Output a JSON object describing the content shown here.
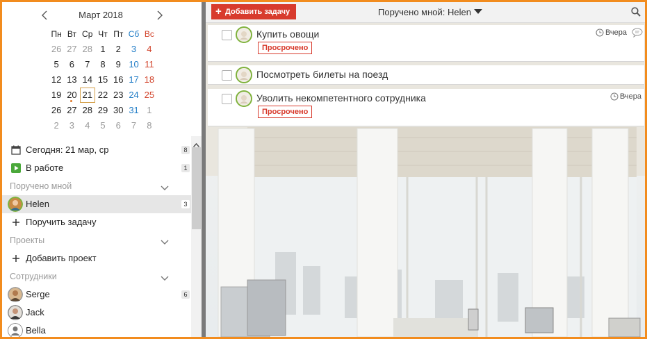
{
  "calendar": {
    "title": "Март 2018",
    "weekdays": [
      {
        "label": "Пн",
        "kind": "norm"
      },
      {
        "label": "Вт",
        "kind": "norm"
      },
      {
        "label": "Ср",
        "kind": "norm"
      },
      {
        "label": "Чт",
        "kind": "norm"
      },
      {
        "label": "Пт",
        "kind": "norm"
      },
      {
        "label": "Сб",
        "kind": "sat"
      },
      {
        "label": "Вс",
        "kind": "sun"
      }
    ],
    "weeks": [
      [
        {
          "d": "26",
          "k": "muted"
        },
        {
          "d": "27",
          "k": "muted"
        },
        {
          "d": "28",
          "k": "muted"
        },
        {
          "d": "1",
          "k": "norm"
        },
        {
          "d": "2",
          "k": "norm"
        },
        {
          "d": "3",
          "k": "sat"
        },
        {
          "d": "4",
          "k": "sun"
        }
      ],
      [
        {
          "d": "5",
          "k": "norm"
        },
        {
          "d": "6",
          "k": "norm"
        },
        {
          "d": "7",
          "k": "norm"
        },
        {
          "d": "8",
          "k": "norm"
        },
        {
          "d": "9",
          "k": "norm"
        },
        {
          "d": "10",
          "k": "sat"
        },
        {
          "d": "11",
          "k": "sun"
        }
      ],
      [
        {
          "d": "12",
          "k": "norm"
        },
        {
          "d": "13",
          "k": "norm"
        },
        {
          "d": "14",
          "k": "norm"
        },
        {
          "d": "15",
          "k": "norm"
        },
        {
          "d": "16",
          "k": "norm"
        },
        {
          "d": "17",
          "k": "sat"
        },
        {
          "d": "18",
          "k": "sun"
        }
      ],
      [
        {
          "d": "19",
          "k": "norm"
        },
        {
          "d": "20",
          "k": "norm",
          "dot": true
        },
        {
          "d": "21",
          "k": "norm",
          "today": true
        },
        {
          "d": "22",
          "k": "norm"
        },
        {
          "d": "23",
          "k": "norm"
        },
        {
          "d": "24",
          "k": "sat"
        },
        {
          "d": "25",
          "k": "sun"
        }
      ],
      [
        {
          "d": "26",
          "k": "norm"
        },
        {
          "d": "27",
          "k": "norm"
        },
        {
          "d": "28",
          "k": "norm"
        },
        {
          "d": "29",
          "k": "norm"
        },
        {
          "d": "30",
          "k": "norm"
        },
        {
          "d": "31",
          "k": "sat"
        },
        {
          "d": "1",
          "k": "muted"
        }
      ],
      [
        {
          "d": "2",
          "k": "muted"
        },
        {
          "d": "3",
          "k": "muted"
        },
        {
          "d": "4",
          "k": "muted"
        },
        {
          "d": "5",
          "k": "muted"
        },
        {
          "d": "6",
          "k": "muted"
        },
        {
          "d": "7",
          "k": "muted"
        },
        {
          "d": "8",
          "k": "muted"
        }
      ]
    ]
  },
  "sidebar": {
    "today": {
      "label": "Сегодня: 21 мар, ср",
      "count": "8",
      "icon": "calendar-icon"
    },
    "in_progress": {
      "label": "В работе",
      "count": "1",
      "icon": "play-icon"
    },
    "assigned_section": "Поручено мной",
    "helen": {
      "label": "Helen",
      "count": "3"
    },
    "assign_task": "Поручить задачу",
    "projects_section": "Проекты",
    "add_project": "Добавить проект",
    "employees_section": "Сотрудники",
    "serge": {
      "label": "Serge",
      "count": "6"
    },
    "jack": {
      "label": "Jack"
    },
    "bella": {
      "label": "Bella"
    }
  },
  "toolbar": {
    "add_task": "Добавить задачу",
    "filter": "Поручено мной: Helen"
  },
  "tasks": [
    {
      "title": "Купить овощи",
      "status": "Просрочено",
      "due": "Вчера",
      "has_comment": true
    },
    {
      "title": "Посмотреть билеты на поезд"
    },
    {
      "title": "Уволить некомпетентного сотрудника",
      "status": "Просрочено",
      "due": "Вчера"
    }
  ],
  "colors": {
    "accent": "#d83b2d",
    "frame": "#f28c1e",
    "saturday": "#1e7bc6",
    "sunday": "#d2442c",
    "avatar_ring": "#7fb23c"
  }
}
